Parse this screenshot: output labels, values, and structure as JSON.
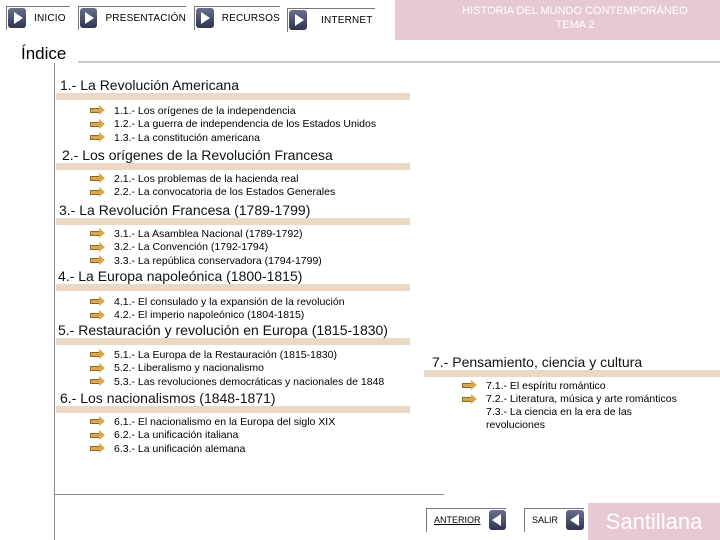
{
  "nav": {
    "inicio": "INICIO",
    "presentacion": "PRESENTACIÓN",
    "recursos": "RECURSOS",
    "internet": "INTERNET"
  },
  "header": {
    "title_line1": "HISTORIA DEL MUNDO CONTEMPORÁNEO",
    "title_line2": "TEMA 2"
  },
  "index_title": "Índice",
  "sections": [
    {
      "title": "1.- La Revolución Americana",
      "items": [
        "1.1.- Los orígenes de la independencia",
        "1.2.- La guerra de independencia de los Estados Unidos",
        "1.3.- La constitución americana"
      ]
    },
    {
      "title": "2.- Los orígenes de la Revolución Francesa",
      "items": [
        "2.1.- Los problemas de la hacienda real",
        "2.2.- La convocatoria de los Estados Generales"
      ]
    },
    {
      "title": "3.- La Revolución Francesa (1789-1799)",
      "items": [
        "3.1.- La Asamblea Nacional (1789-1792)",
        "3.2.- La Convención (1792-1794)",
        "3.3.- La república conservadora (1794-1799)"
      ]
    },
    {
      "title": "4.- La Europa napoleónica (1800-1815)",
      "items": [
        "4.1.- El consulado y la expansión de la revolución",
        "4.2.- El imperio napoleónico (1804-1815)"
      ]
    },
    {
      "title": "5.- Restauración y revolución en Europa (1815-1830)",
      "items": [
        "5.1.- La Europa de la Restauración (1815-1830)",
        "5.2.- Liberalismo y nacionalismo",
        "5.3.- Las revoluciones democráticas y nacionales de 1848"
      ]
    },
    {
      "title": "6.- Los nacionalismos (1848-1871)",
      "items": [
        "6.1.- El nacionalismo en la Europa del siglo XIX",
        "6.2.- La unificación italiana",
        "6.3.- La unificación alemana"
      ]
    },
    {
      "title": "7.- Pensamiento, ciencia y cultura",
      "items": [
        "7.1.- El espíritu romántico",
        "7.2.- Literatura, música y arte románticos",
        "7.3.- La ciencia en la era de las revoluciones"
      ]
    }
  ],
  "footer": {
    "anterior": "ANTERIOR",
    "salir": "SALIR",
    "brand": "Santillana"
  },
  "colors": {
    "header_band": "#e7c9d5",
    "section_bar": "#ead8c4",
    "arrow": "#d8a84d",
    "button_icon": "#3b4060"
  }
}
